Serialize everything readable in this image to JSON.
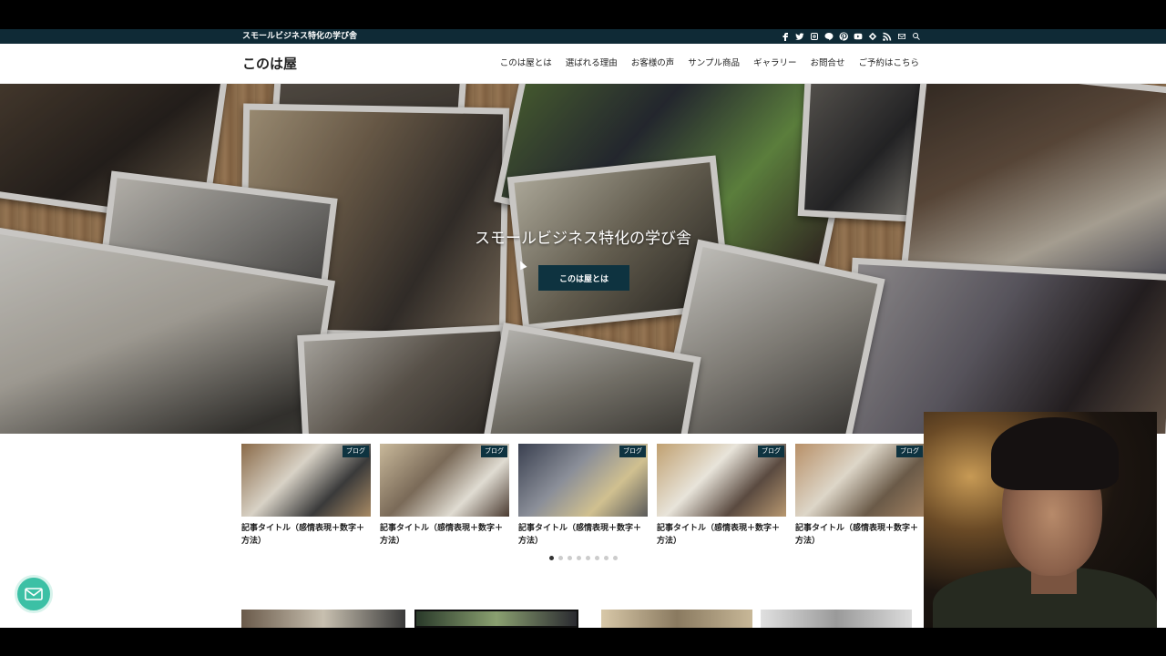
{
  "topbar": {
    "tagline": "スモールビジネス特化の学び舎",
    "social_icons": [
      "facebook-icon",
      "twitter-icon",
      "instagram-icon",
      "line-icon",
      "pinterest-icon",
      "youtube-icon",
      "feedly-icon",
      "rss-icon",
      "mail-icon",
      "search-icon"
    ]
  },
  "header": {
    "logo": "このは屋",
    "nav": [
      {
        "label": "このは屋とは"
      },
      {
        "label": "選ばれる理由"
      },
      {
        "label": "お客様の声"
      },
      {
        "label": "サンプル商品"
      },
      {
        "label": "ギャラリー"
      },
      {
        "label": "お問合せ"
      },
      {
        "label": "ご予約はこちら"
      }
    ]
  },
  "hero": {
    "title": "スモールビジネス特化の学び舎",
    "button_label": "このは屋とは"
  },
  "cards": [
    {
      "badge": "ブログ",
      "title": "記事タイトル（感情表現＋数字＋方法）"
    },
    {
      "badge": "ブログ",
      "title": "記事タイトル（感情表現＋数字＋方法）"
    },
    {
      "badge": "ブログ",
      "title": "記事タイトル（感情表現＋数字＋方法）"
    },
    {
      "badge": "ブログ",
      "title": "記事タイトル（感情表現＋数字＋方法）"
    },
    {
      "badge": "ブログ",
      "title": "記事タイトル（感情表現＋数字＋方法）"
    }
  ],
  "carousel": {
    "dot_count": 8,
    "active_index": 0
  },
  "colors": {
    "topbar": "#0f2a36",
    "accent_button": "#0e3340",
    "mail_button": "#3cc0a5"
  }
}
